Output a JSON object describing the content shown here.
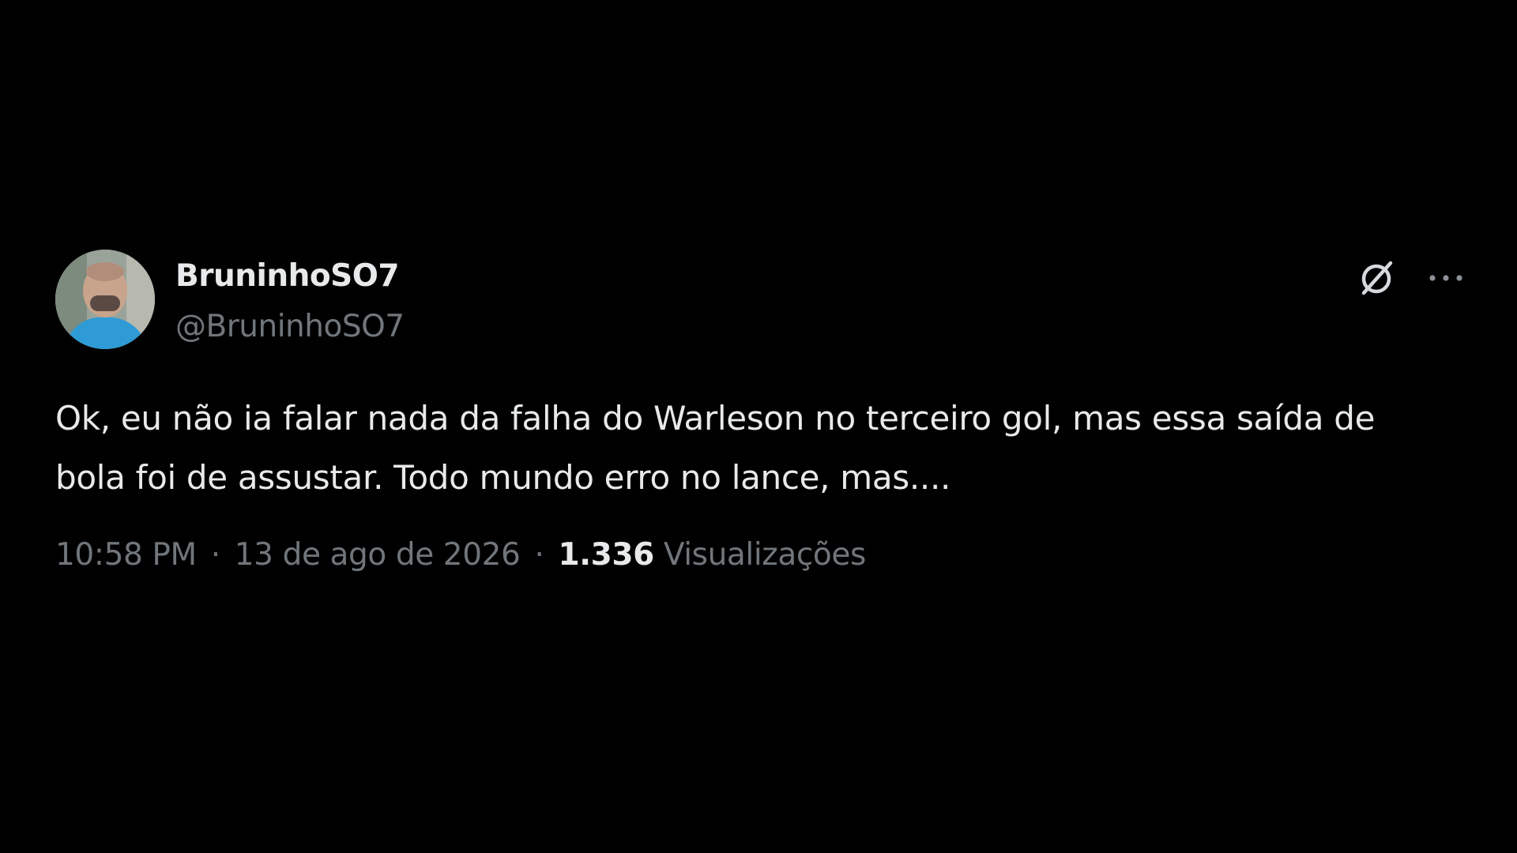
{
  "tweet": {
    "display_name": "BruninhoSO7",
    "handle": "@BruninhoSO7",
    "text": "Ok, eu não ia falar nada da falha do Warleson no terceiro gol, mas essa saída de bola foi de assustar. Todo mundo erro no lance, mas....",
    "time": "10:58 PM",
    "date": "13 de ago de 2026",
    "separator": "·",
    "views_count": "1.336",
    "views_label": "Visualizações"
  },
  "icons": {
    "grok": "grok-icon",
    "more": "more-options-icon",
    "avatar": "avatar"
  },
  "colors": {
    "background": "#000000",
    "primary_text": "#e7e9ea",
    "secondary_text": "#71767b",
    "avatar_shirt": "#2e9bd6"
  }
}
